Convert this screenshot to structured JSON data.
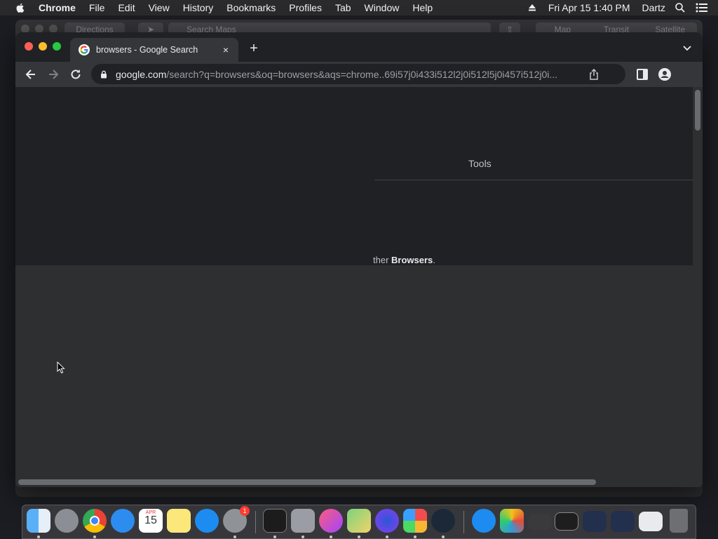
{
  "menubar": {
    "app_name": "Chrome",
    "items": [
      "File",
      "Edit",
      "View",
      "History",
      "Bookmarks",
      "Profiles",
      "Tab",
      "Window",
      "Help"
    ],
    "clock": "Fri Apr 15  1:40 PM",
    "user": "Dartz"
  },
  "background_window": {
    "directions_label": "Directions",
    "search_placeholder": "Search Maps",
    "segments": [
      "Map",
      "Transit",
      "Satellite"
    ]
  },
  "browser": {
    "tab": {
      "title": "browsers - Google Search",
      "close": "×"
    },
    "new_tab": "+",
    "url_host": "google.com",
    "url_rest": "/search?q=browsers&oq=browsers&aqs=chrome..69i57j0i433i512l2j0i512l5j0i457i512j0i..."
  },
  "page": {
    "tools_label": "Tools",
    "snippet_prefix": "ther ",
    "snippet_bold": "Browsers",
    "snippet_suffix": "."
  },
  "dock": {
    "calendar_month": "APR",
    "calendar_day": "15",
    "settings_badge": "1",
    "apps": [
      "finder",
      "launchpad",
      "chrome",
      "safari",
      "calendar",
      "notes",
      "app-store",
      "system-preferences",
      "terminal",
      "migration-assistant",
      "itunes",
      "maps",
      "firefox",
      "pinwheel",
      "steam",
      "app-store-2",
      "photos",
      "window-1",
      "window-2",
      "window-3",
      "window-4",
      "window-5",
      "trash"
    ]
  }
}
